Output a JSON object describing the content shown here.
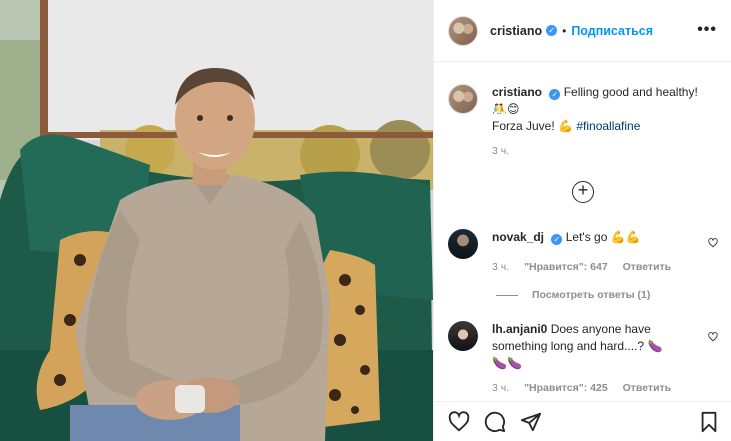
{
  "header": {
    "username": "cristiano",
    "verified_icon": "verified-badge-icon",
    "separator": "•",
    "follow_label": "Подписаться",
    "more_label": "•••"
  },
  "caption": {
    "username": "cristiano",
    "line1": "Felling good and healthy!",
    "line2": "🤼😊",
    "line3_text": "Forza Juve!",
    "line3_emoji": "💪",
    "hashtag": "#finoallafine",
    "time": "3 ч."
  },
  "load_more_label": "+",
  "comments": [
    {
      "username": "novak_dj",
      "verified": true,
      "text": "Let's go",
      "emoji": "💪💪",
      "time": "3 ч.",
      "likes": "\"Нравится\": 647",
      "reply": "Ответить"
    },
    {
      "username": "lh.anjani0",
      "verified": false,
      "text": "Does anyone have something long and hard....?",
      "emoji": "🍆",
      "emoji2": "🍆🍆",
      "time": "3 ч.",
      "likes": "\"Нравится\": 425",
      "reply": "Ответить"
    }
  ],
  "view_replies": "Посмотреть ответы (1)",
  "colors": {
    "link": "#0095f6",
    "hashtag": "#00376b",
    "muted": "#8e8e8e",
    "verified": "#3897f0"
  },
  "icons": {
    "like": "heart-icon",
    "comment": "comment-icon",
    "share": "share-icon",
    "save": "bookmark-icon"
  }
}
